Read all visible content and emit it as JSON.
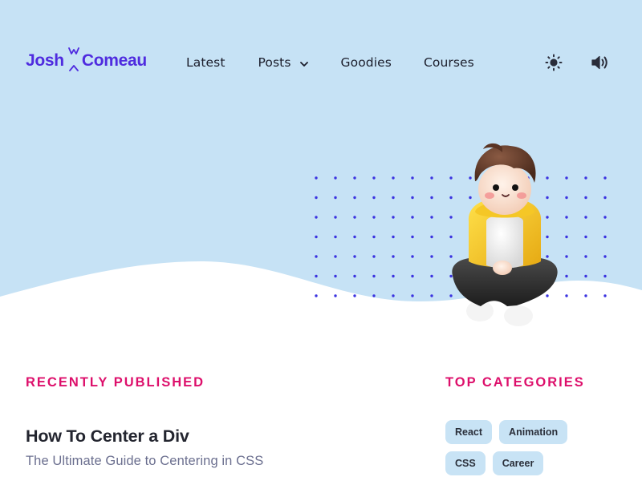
{
  "brand": {
    "first": "Josh",
    "last": "Comeau",
    "color": "#4f2bdf"
  },
  "nav": {
    "items": [
      {
        "label": "Latest"
      },
      {
        "label": "Posts",
        "has_dropdown": true
      },
      {
        "label": "Goodies"
      },
      {
        "label": "Courses"
      }
    ]
  },
  "header_icons": {
    "theme": "sun-icon",
    "sound": "speaker-volume-icon"
  },
  "recent": {
    "heading": "RECENTLY PUBLISHED",
    "posts": [
      {
        "title": "How To Center a Div",
        "subtitle": "The Ultimate Guide to Centering in CSS"
      }
    ]
  },
  "categories": {
    "heading": "TOP CATEGORIES",
    "items": [
      "React",
      "Animation",
      "CSS",
      "Career"
    ]
  },
  "colors": {
    "hero_bg": "#c6e2f5",
    "accent_pink": "#dd0f6b",
    "dots": "#3b33e0",
    "chip_bg": "#c8e3f5"
  }
}
